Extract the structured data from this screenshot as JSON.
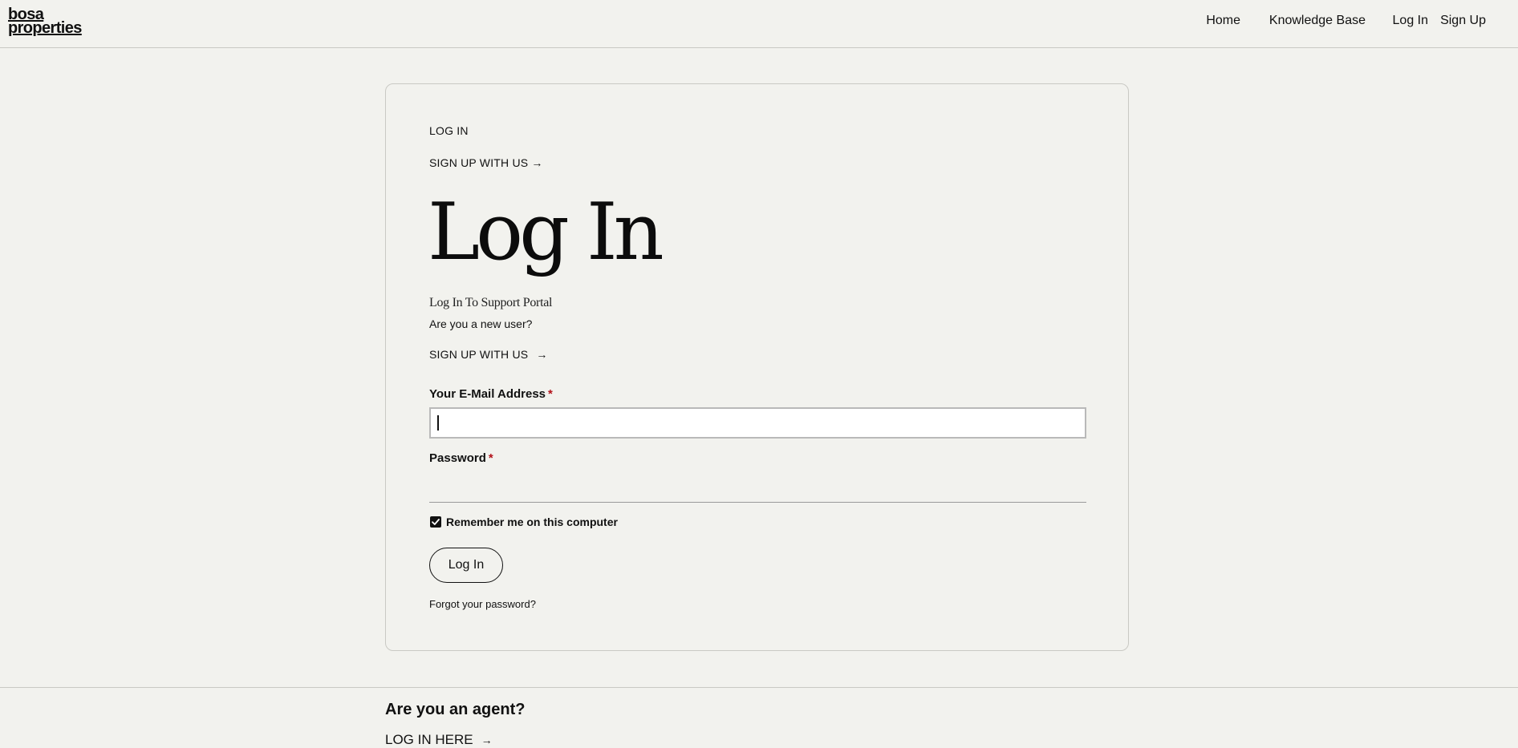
{
  "header": {
    "logo_line1": "bosa",
    "logo_line2": "properties",
    "nav": {
      "home": "Home",
      "knowledge_base": "Knowledge Base",
      "log_in": "Log In",
      "sign_up": "Sign Up"
    }
  },
  "card": {
    "top_log_in_link": "LOG IN",
    "top_sign_up_link": "SIGN UP WITH US",
    "title": "Log In",
    "subtitle": "Log In To Support Portal",
    "new_user_text": "Are you a new user?",
    "sign_up_link": "SIGN UP WITH US",
    "arrow_glyph": "→",
    "email_label": "Your E-Mail Address",
    "email_value": "",
    "password_label": "Password",
    "required_marker": "*",
    "remember_label": "Remember me on this computer",
    "remember_checked": true,
    "login_button": "Log In",
    "forgot_link": "Forgot your password?"
  },
  "footer": {
    "agent_heading": "Are you an agent?",
    "agent_link": "LOG IN HERE"
  },
  "colors": {
    "background": "#f2f2ee",
    "text": "#111111",
    "required": "#b3121a",
    "border": "#c9c9c4"
  }
}
